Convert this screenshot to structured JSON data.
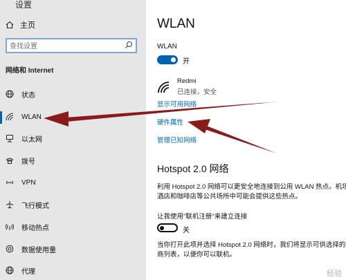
{
  "window": {
    "title": "设置"
  },
  "sidebar": {
    "home_label": "主页",
    "search_placeholder": "查找设置",
    "section_title": "网络和 Internet",
    "items": [
      {
        "id": "status",
        "label": "状态",
        "icon": "globe-icon"
      },
      {
        "id": "wlan",
        "label": "WLAN",
        "icon": "wifi-icon",
        "active": true
      },
      {
        "id": "ethernet",
        "label": "以太网",
        "icon": "ethernet-icon"
      },
      {
        "id": "dialup",
        "label": "拨号",
        "icon": "phone-icon"
      },
      {
        "id": "vpn",
        "label": "VPN",
        "icon": "vpn-icon"
      },
      {
        "id": "airplane",
        "label": "飞行模式",
        "icon": "airplane-icon"
      },
      {
        "id": "hotspot",
        "label": "移动热点",
        "icon": "hotspot-icon"
      },
      {
        "id": "datausage",
        "label": "数据使用量",
        "icon": "data-usage-icon"
      },
      {
        "id": "proxy",
        "label": "代理",
        "icon": "globe-icon"
      }
    ]
  },
  "main": {
    "title": "WLAN",
    "wlan_label": "WLAN",
    "wlan_toggle_state": "开",
    "network": {
      "name": "Redmi",
      "status": "已连接，安全"
    },
    "links": {
      "show_available": "显示可用网络",
      "hardware_properties": "硬件属性",
      "manage_known": "管理已知网络"
    },
    "hotspot20": {
      "title": "Hotspot 2.0 网络",
      "description_line1": "利用 Hotspot 2.0 网络可以更安全地连接到公用 WLAN 热点。机场、",
      "description_line2": "酒店和咖啡店等公共场所中可能会提供这些热点。",
      "signup_label": "让我使用\"联机注册\"来建立连接",
      "signup_toggle_state": "关",
      "info_line1": "当你打开此项并选择 Hotspot 2.0 网络时，我们将显示可供选择的提",
      "info_line2": "商列表，以便你可以联机。"
    }
  },
  "colors": {
    "accent": "#0063b1",
    "link": "#0067c0",
    "annotation_arrow": "#8b1a1a"
  },
  "watermark": "经验"
}
